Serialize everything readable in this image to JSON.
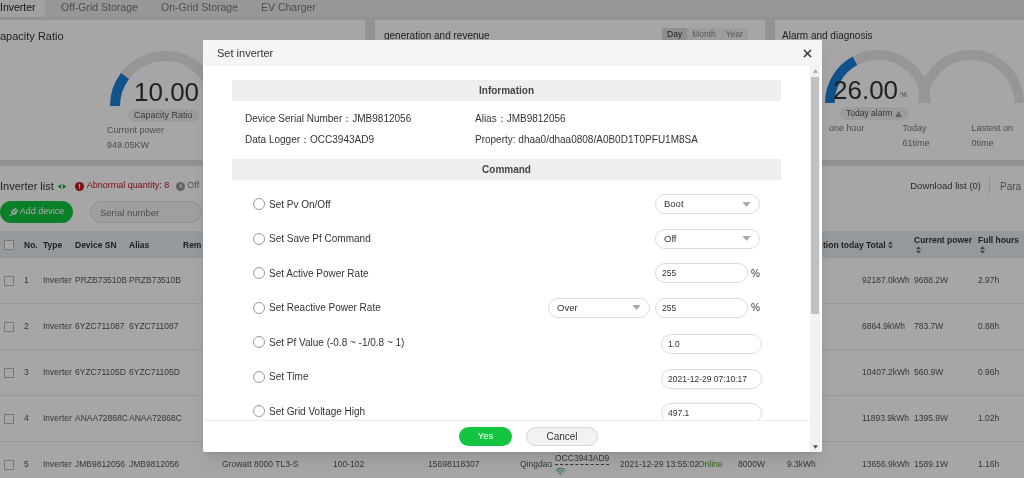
{
  "tabs": [
    {
      "label": "Inverter",
      "selected": true
    },
    {
      "label": "Off-Grid Storage",
      "selected": false
    },
    {
      "label": "On-Grid Storage",
      "selected": false
    },
    {
      "label": "EV Charger",
      "selected": false
    }
  ],
  "capacity_card": {
    "title": "apacity Ratio",
    "value": "10.00",
    "level": 0.1,
    "badge": "Capacity Ratio",
    "stat_label": "Current power",
    "stat_value": "949.05KW"
  },
  "generation_card": {
    "title": "generation and revenue",
    "periods": [
      {
        "label": "Day",
        "selected": true
      },
      {
        "label": "Month",
        "selected": false
      },
      {
        "label": "Year",
        "selected": false
      }
    ]
  },
  "alarm_card": {
    "title": "Alarm and diagnosis",
    "value": "26.00",
    "unit": "%",
    "level": 0.26,
    "badge": "Today alarm",
    "stats": [
      {
        "label": "one hour"
      },
      {
        "label": "Today",
        "value": "61time"
      },
      {
        "label": "Lastest on",
        "value": "0time"
      }
    ]
  },
  "inverter_list": {
    "title": "Inverter list",
    "abnormal": "Abnormal quantity: 8",
    "offline": "Off",
    "download": "Download list (0)",
    "param": "Para",
    "add_button": "Add device",
    "search": {
      "placeholder": "Serial number"
    }
  },
  "table": {
    "all_checked": false,
    "columns": {
      "no": {
        "label": "No."
      },
      "type": {
        "label": "Type"
      },
      "sn": {
        "label": "Device SN"
      },
      "alias": {
        "label": "Alias"
      },
      "remark": {
        "label": "Rem"
      },
      "generation_today": {
        "label": "tion today"
      },
      "total": {
        "label": "Total",
        "sortable": true
      },
      "current_power": {
        "label": "Current power",
        "sortable": true
      },
      "full_hours": {
        "label": "Full hours",
        "sortable": true
      }
    },
    "rows": [
      {
        "checked": false,
        "no": "1",
        "type": "Inverter",
        "sn": "PRZB73510B",
        "alias": "PRZB73510B",
        "total": "92187.0kWh",
        "current_power": "9688.2W",
        "full_hours": "2.97h"
      },
      {
        "checked": false,
        "no": "2",
        "type": "Inverter",
        "sn": "6YZC711087",
        "alias": "6YZC711087",
        "total": "6864.9kWh",
        "current_power": "783.7W",
        "full_hours": "0.88h"
      },
      {
        "checked": false,
        "no": "3",
        "type": "Inverter",
        "sn": "6YZC71105D",
        "alias": "6YZC71105D",
        "total": "10407.2kWh",
        "current_power": "560.9W",
        "full_hours": "0.96h"
      },
      {
        "checked": false,
        "no": "4",
        "type": "Inverter",
        "sn": "ANAA72868C",
        "alias": "ANAA72868C",
        "total": "11893.9kWh",
        "current_power": "1395.9W",
        "full_hours": "1.02h"
      },
      {
        "checked": false,
        "no": "5",
        "type": "Inverter",
        "sn": "JMB9812056",
        "alias": "JMB9812056",
        "model": "Growatt 8000 TL3-S",
        "column_7": "100-102",
        "column_8": "15698118307",
        "column_9": "Qingdao",
        "datalogger": "OCC3943AD9",
        "time": "2021-12-29 13:55:02",
        "status": "Online",
        "power": "8000W",
        "generation_today": "9.3kWh",
        "total": "13656.9kWh",
        "current_power": "1589.1W",
        "full_hours": "1.16h"
      }
    ]
  },
  "dialog": {
    "title": "Set inverter",
    "info_header": "Information",
    "info": [
      "Device Serial Number：JMB9812056",
      "Alias：JMB9812056",
      "Data Logger：OCC3943AD9",
      "Property: dhaa0/dhaa0808/A0B0D1T0PFU1M8SA"
    ],
    "command_header": "Command",
    "commands": [
      {
        "label": "Set Pv On/Off",
        "selected": false,
        "kind": "select",
        "value": "Boot"
      },
      {
        "label": "Set Save Pf Command",
        "selected": false,
        "kind": "select",
        "value": "Off"
      },
      {
        "label": "Set Active Power Rate",
        "selected": false,
        "kind": "input",
        "value": "255",
        "unit": "%"
      },
      {
        "label": "Set Reactive Power Rate",
        "selected": false,
        "kind": "select_input",
        "option": "Over",
        "value": "255",
        "unit": "%"
      },
      {
        "label": "Set Pf Value (-0.8 ~ -1/0.8 ~ 1)",
        "selected": false,
        "kind": "input",
        "value": "1.0"
      },
      {
        "label": "Set Time",
        "selected": false,
        "kind": "input",
        "value": "2021-12-29 07:10:17"
      },
      {
        "label": "Set Grid Voltage High",
        "selected": false,
        "kind": "input",
        "value": "497.1"
      }
    ],
    "buttons": [
      {
        "label": "Yes",
        "kind": "primary"
      },
      {
        "label": "Cancel",
        "kind": "secondary"
      }
    ]
  }
}
